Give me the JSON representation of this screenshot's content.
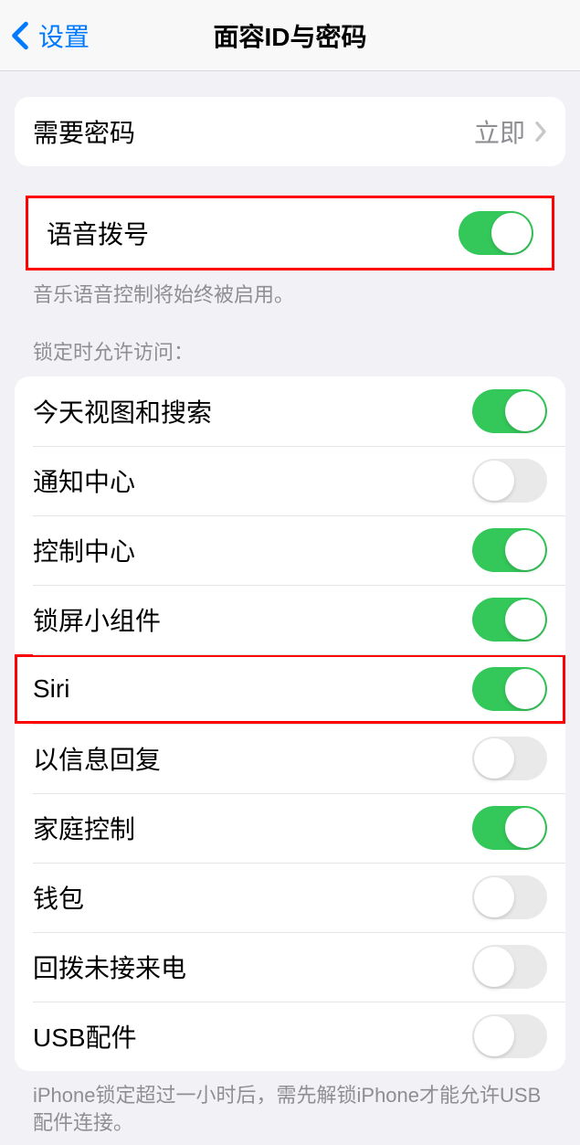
{
  "header": {
    "back": "设置",
    "title": "面容ID与密码"
  },
  "requirePasscode": {
    "label": "需要密码",
    "value": "立即"
  },
  "voiceDial": {
    "label": "语音拨号",
    "on": true,
    "highlighted": true,
    "footer": "音乐语音控制将始终被启用。"
  },
  "lockedAccess": {
    "header": "锁定时允许访问：",
    "items": [
      {
        "label": "今天视图和搜索",
        "on": true,
        "highlighted": false
      },
      {
        "label": "通知中心",
        "on": false,
        "highlighted": false
      },
      {
        "label": "控制中心",
        "on": true,
        "highlighted": false
      },
      {
        "label": "锁屏小组件",
        "on": true,
        "highlighted": false
      },
      {
        "label": "Siri",
        "on": true,
        "highlighted": true
      },
      {
        "label": "以信息回复",
        "on": false,
        "highlighted": false
      },
      {
        "label": "家庭控制",
        "on": true,
        "highlighted": false
      },
      {
        "label": "钱包",
        "on": false,
        "highlighted": false
      },
      {
        "label": "回拨未接来电",
        "on": false,
        "highlighted": false
      },
      {
        "label": "USB配件",
        "on": false,
        "highlighted": false
      }
    ],
    "footer": "iPhone锁定超过一小时后，需先解锁iPhone才能允许USB配件连接。"
  }
}
